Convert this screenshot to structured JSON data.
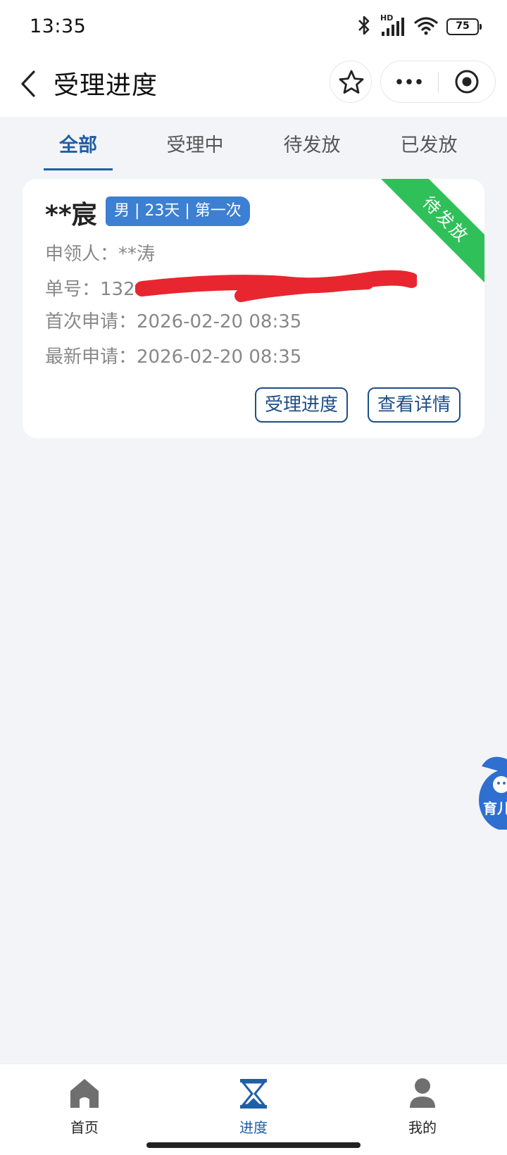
{
  "status_bar": {
    "time": "13:35",
    "battery": "75",
    "signal_label": "HD"
  },
  "nav": {
    "title": "受理进度"
  },
  "tabs": [
    {
      "label": "全部",
      "active": true
    },
    {
      "label": "受理中",
      "active": false
    },
    {
      "label": "待发放",
      "active": false
    },
    {
      "label": "已发放",
      "active": false
    }
  ],
  "card": {
    "name": "**宸",
    "tag": "男 | 23天 | 第一次",
    "status_ribbon": "待发放",
    "applicant": "申领人：**涛",
    "order_number": "单号：132",
    "first_apply": "首次申请：2026-02-20 08:35",
    "latest_apply": "最新申请：2026-02-20 08:35",
    "buttons": {
      "progress": "受理进度",
      "detail": "查看详情"
    }
  },
  "float_badge": {
    "label": "育儿"
  },
  "tabbar": [
    {
      "label": "首页",
      "icon": "home-icon",
      "active": false
    },
    {
      "label": "进度",
      "icon": "hourglass-icon",
      "active": true
    },
    {
      "label": "我的",
      "icon": "user-icon",
      "active": false
    }
  ],
  "colors": {
    "accent": "#1f5fa6",
    "ribbon": "#2fc05a",
    "tag": "#3d7fd2",
    "redaction": "#e8262f"
  }
}
